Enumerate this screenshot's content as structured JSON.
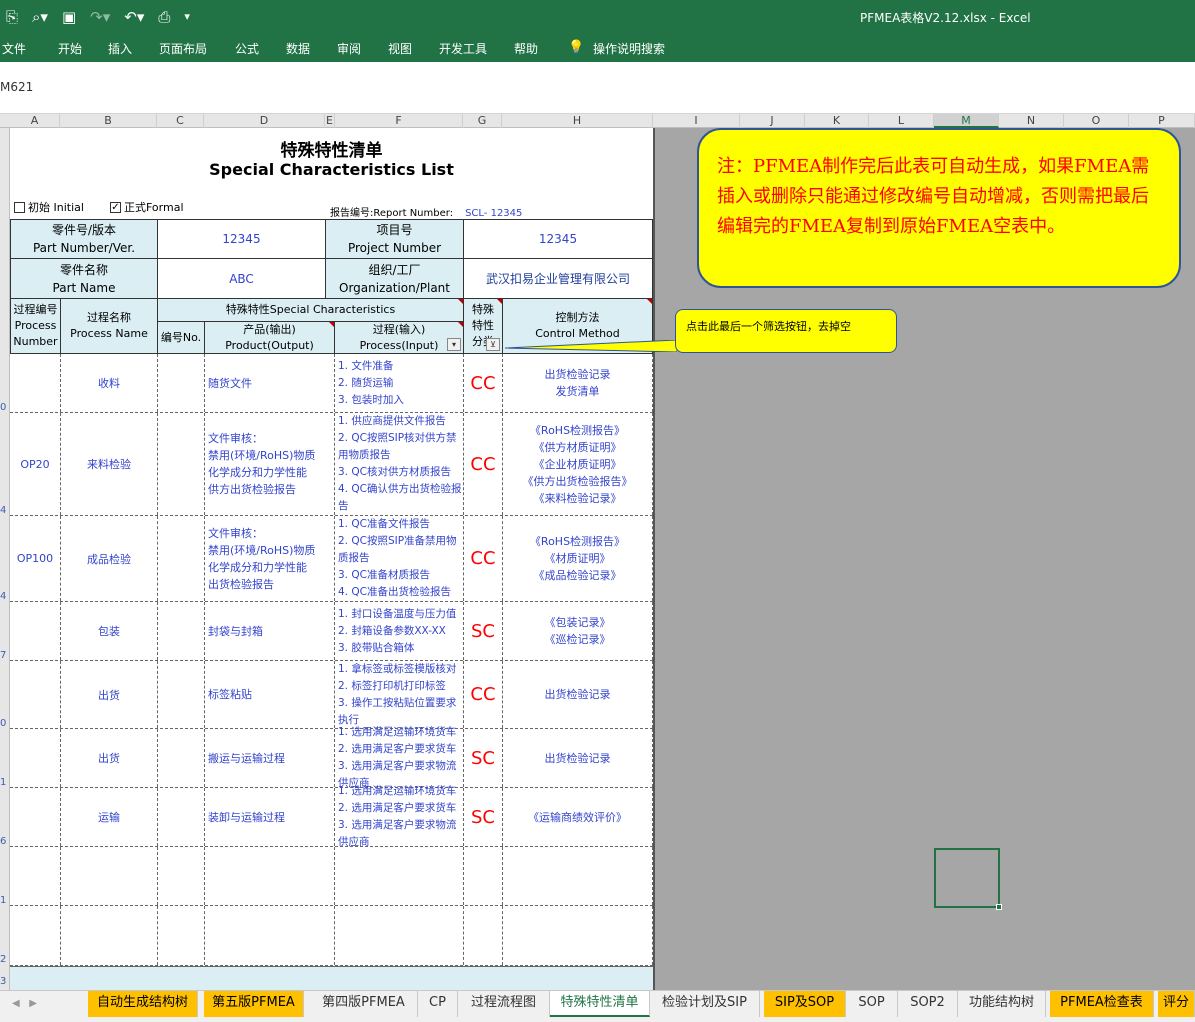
{
  "app": {
    "doc_title": "PFMEA表格V2.12.xlsx - Excel",
    "name_box": "M621"
  },
  "ribbon": {
    "tabs": [
      "文件",
      "开始",
      "插入",
      "页面布局",
      "公式",
      "数据",
      "审阅",
      "视图",
      "开发工具",
      "帮助"
    ],
    "search": "操作说明搜索"
  },
  "columns": [
    "A",
    "B",
    "C",
    "D",
    "E",
    "F",
    "G",
    "H",
    "I",
    "J",
    "K",
    "L",
    "M",
    "N",
    "O",
    "P"
  ],
  "row_numbers": [
    "0",
    "4",
    "4",
    "7",
    "0",
    "1",
    "6",
    "1",
    "2",
    "3"
  ],
  "sheet": {
    "title_cn": "特殊特性清单",
    "title_en": "Special Characteristics List",
    "initial_label": "初始 Initial",
    "formal_label": "正式Formal",
    "formal_checked": "✓",
    "report_label": "报告编号:Report Number:",
    "report_value": "SCL- 12345",
    "info": {
      "part_no_cn": "零件号/版本",
      "part_no_en": "Part Number/Ver.",
      "part_no_value": "12345",
      "project_cn": "项目号",
      "project_en": "Project Number",
      "project_value": "12345",
      "part_name_cn": "零件名称",
      "part_name_en": "Part Name",
      "part_name_value": "ABC",
      "org_cn": "组织/工厂",
      "org_en": "Organization/Plant",
      "org_value": "武汉扣易企业管理有限公司"
    },
    "headers": {
      "proc_no_cn": "过程编号",
      "proc_no_en1": "Process",
      "proc_no_en2": "Number",
      "proc_name_cn": "过程名称",
      "proc_name_en": "Process Name",
      "special": "特殊特性Special Characteristics",
      "no": "编号No.",
      "product_cn": "产品(输出)",
      "product_en": "Product(Output)",
      "process_cn": "过程(输入)",
      "process_en": "Process(Input)",
      "class_1": "特殊",
      "class_2": "特性",
      "class_3": "分类",
      "control_cn": "控制方法",
      "control_en": "Control Method"
    },
    "rows": [
      {
        "proc_no": "",
        "proc_name": "收料",
        "no": "",
        "product": [
          "随货文件"
        ],
        "process": [
          "1. 文件准备",
          "2. 随货运输",
          "3. 包装时加入"
        ],
        "cls": "CC",
        "control": [
          "出货检验记录",
          "发货清单"
        ]
      },
      {
        "proc_no": "OP20",
        "proc_name": "来料检验",
        "no": "",
        "product": [
          "文件审核：",
          "禁用(环境/RoHS)物质",
          "化学成分和力学性能",
          "供方出货检验报告"
        ],
        "process": [
          "1. 供应商提供文件报告",
          "2. QC按照SIP核对供方禁用物质报告",
          "3. QC核对供方材质报告",
          "4. QC确认供方出货检验报告"
        ],
        "cls": "CC",
        "control": [
          "《RoHS检测报告》",
          "《供方材质证明》",
          "《企业材质证明》",
          "《供方出货检验报告》",
          "《来料检验记录》"
        ]
      },
      {
        "proc_no": "OP100",
        "proc_name": "成品检验",
        "no": "",
        "product": [
          "文件审核：",
          "禁用(环境/RoHS)物质",
          "化学成分和力学性能",
          "出货检验报告"
        ],
        "process": [
          "1. QC准备文件报告",
          "2. QC按照SIP准备禁用物质报告",
          "3. QC准备材质报告",
          "4. QC准备出货检验报告"
        ],
        "cls": "CC",
        "control": [
          "《RoHS检测报告》",
          "《材质证明》",
          "《成品检验记录》"
        ]
      },
      {
        "proc_no": "",
        "proc_name": "包装",
        "no": "",
        "product": [
          "封袋与封箱"
        ],
        "process": [
          "1. 封口设备温度与压力值",
          "2. 封箱设备参数XX-XX",
          "3. 胶带贴合箱体"
        ],
        "cls": "SC",
        "control": [
          "《包装记录》",
          "《巡检记录》"
        ]
      },
      {
        "proc_no": "",
        "proc_name": "出货",
        "no": "",
        "product": [
          "标签粘贴"
        ],
        "process": [
          "1. 拿标签或标签模版核对",
          "2. 标签打印机打印标签",
          "3. 操作工按粘贴位置要求执行"
        ],
        "cls": "CC",
        "control": [
          "出货检验记录"
        ]
      },
      {
        "proc_no": "",
        "proc_name": "出货",
        "no": "",
        "product": [
          "搬运与运输过程"
        ],
        "process": [
          "1. 选用满足运输环境货车",
          "2. 选用满足客户要求货车",
          "3. 选用满足客户要求物流供应商"
        ],
        "cls": "SC",
        "control": [
          "出货检验记录"
        ]
      },
      {
        "proc_no": "",
        "proc_name": "运输",
        "no": "",
        "product": [
          "装卸与运输过程"
        ],
        "process": [
          "1. 选用满足运输环境货车",
          "2. 选用满足客户要求货车",
          "3. 选用满足客户要求物流供应商"
        ],
        "cls": "SC",
        "control": [
          "《运输商绩效评价》"
        ]
      }
    ]
  },
  "note": "注：PFMEA制作完后此表可自动生成，如果FMEA需插入或删除只能通过修改编号自动增减，否则需把最后编辑完的FMEA复制到原始FMEA空表中。",
  "tip": "点击此最后一个筛选按钮，去掉空",
  "sheet_tabs": [
    "自动生成结构树",
    "第五版PFMEA",
    "第四版PFMEA",
    "CP",
    "过程流程图",
    "特殊特性清单",
    "检验计划及SIP",
    "SIP及SOP",
    "SOP",
    "SOP2",
    "功能结构树",
    "PFMEA检查表",
    "评分"
  ],
  "colors": {
    "excel_green": "#217346",
    "header_fill": "#daeef3",
    "value_blue": "#3344cc",
    "class_red": "#ff0000",
    "note_yellow": "#ffff00",
    "tab_orange": "#ffc000"
  }
}
